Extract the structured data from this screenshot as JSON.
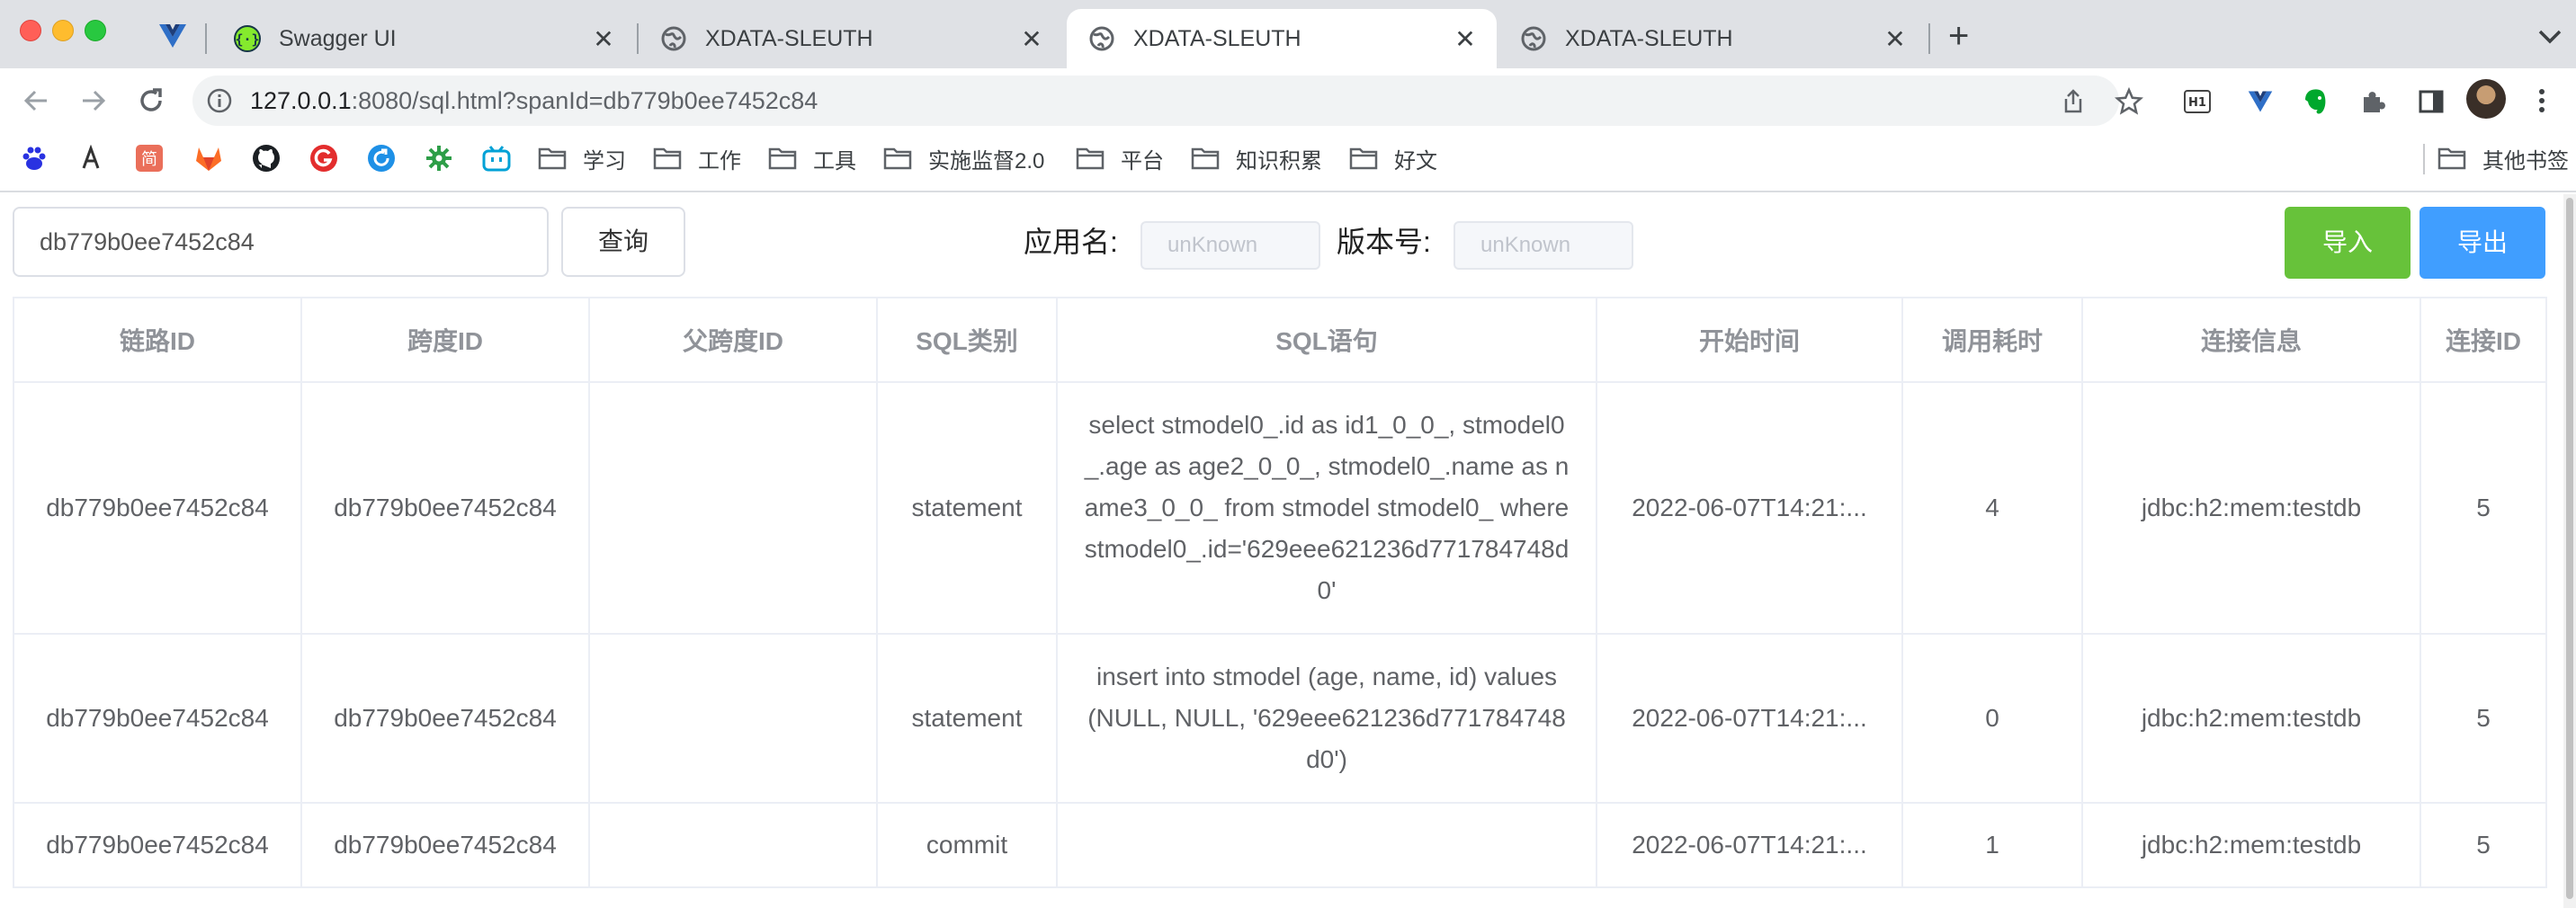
{
  "browser": {
    "tabs": [
      {
        "title": "Swagger UI",
        "active": false
      },
      {
        "title": "XDATA-SLEUTH",
        "active": false
      },
      {
        "title": "XDATA-SLEUTH",
        "active": true
      },
      {
        "title": "XDATA-SLEUTH",
        "active": false
      }
    ],
    "url_host": "127.0.0.1",
    "url_rest": ":8080/sql.html?spanId=db779b0ee7452c84",
    "bookmarks": [
      {
        "label": "学习"
      },
      {
        "label": "工作"
      },
      {
        "label": "工具"
      },
      {
        "label": "实施监督2.0"
      },
      {
        "label": "平台"
      },
      {
        "label": "知识积累"
      },
      {
        "label": "好文"
      }
    ],
    "other_bookmarks": "其他书签",
    "bookmark_icons": [
      "baidu-icon",
      "ali-icon",
      "jianshu-icon",
      "gitlab-icon",
      "github-icon",
      "g-icon",
      "refresh-blue-icon",
      "gear-green-icon",
      "bilibili-icon"
    ],
    "toolbar_icons": [
      "share-icon",
      "star-icon",
      "h1-extension-icon",
      "vue-extension-icon",
      "evernote-icon",
      "puzzle-icon",
      "sidepanel-icon"
    ]
  },
  "controls": {
    "span_id_value": "db779b0ee7452c84",
    "query_label": "查询",
    "app_name_label": "应用名:",
    "app_name_placeholder": "unKnown",
    "version_label": "版本号:",
    "version_placeholder": "unKnown",
    "import_label": "导入",
    "export_label": "导出",
    "import_color": "#67c23a",
    "export_color": "#409eff"
  },
  "table": {
    "headers": [
      "链路ID",
      "跨度ID",
      "父跨度ID",
      "SQL类别",
      "SQL语句",
      "开始时间",
      "调用耗时",
      "连接信息",
      "连接ID"
    ],
    "rows": [
      {
        "trace_id": "db779b0ee7452c84",
        "span_id": "db779b0ee7452c84",
        "parent_span_id": "",
        "sql_type": "statement",
        "sql": "select stmodel0_.id as id1_0_0_, stmodel0_.age as age2_0_0_, stmodel0_.name as name3_0_0_ from stmodel stmodel0_ where stmodel0_.id='629eee621236d771784748d0'",
        "start_time": "2022-06-07T14:21:...",
        "duration": "4",
        "conn_info": "jdbc:h2:mem:testdb",
        "conn_id": "5"
      },
      {
        "trace_id": "db779b0ee7452c84",
        "span_id": "db779b0ee7452c84",
        "parent_span_id": "",
        "sql_type": "statement",
        "sql": "insert into stmodel (age, name, id) values (NULL, NULL, '629eee621236d771784748d0')",
        "start_time": "2022-06-07T14:21:...",
        "duration": "0",
        "conn_info": "jdbc:h2:mem:testdb",
        "conn_id": "5"
      },
      {
        "trace_id": "db779b0ee7452c84",
        "span_id": "db779b0ee7452c84",
        "parent_span_id": "",
        "sql_type": "commit",
        "sql": "",
        "start_time": "2022-06-07T14:21:...",
        "duration": "1",
        "conn_info": "jdbc:h2:mem:testdb",
        "conn_id": "5"
      }
    ]
  }
}
